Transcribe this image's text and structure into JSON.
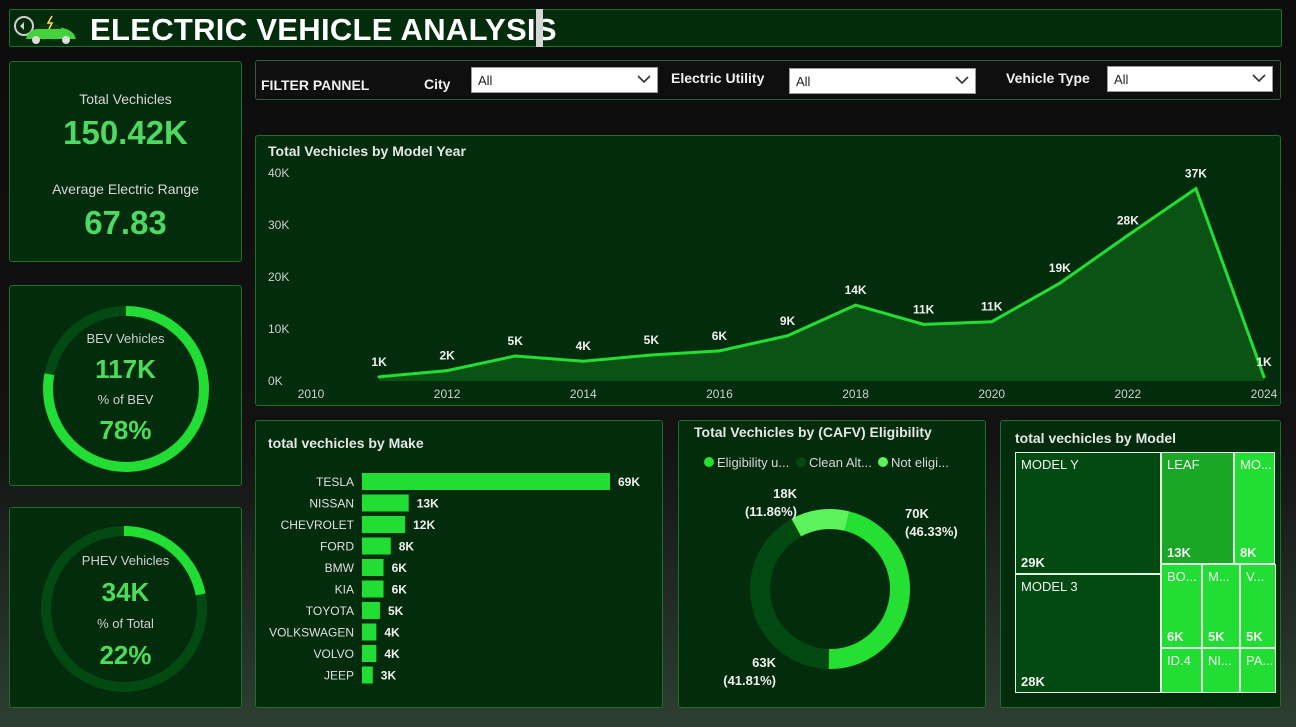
{
  "header": {
    "title": "ELECTRIC VEHICLE ANALYSIS",
    "logo_icon": "ev-car-icon"
  },
  "kpi": {
    "total_label": "Total Vechicles",
    "total_value": "150.42K",
    "range_label": "Average Electric Range",
    "range_value": "67.83"
  },
  "bev": {
    "label": "BEV Vehicles",
    "value": "117K",
    "pct_label": "% of BEV",
    "pct_value": "78%",
    "fraction": 0.78
  },
  "phev": {
    "label": "PHEV Vehicles",
    "value": "34K",
    "pct_label": "% of Total",
    "pct_value": "22%",
    "fraction": 0.22
  },
  "filters": {
    "title": "FILTER PANNEL",
    "city_label": "City",
    "city_value": "All",
    "utility_label": "Electric Utility",
    "utility_value": "All",
    "vehicle_type_label": "Vehicle Type",
    "vehicle_type_value": "All"
  },
  "colors": {
    "accent": "#22dd33",
    "panel": "#022c0b",
    "dark_green": "#034a12",
    "light_green": "#5cf25c"
  },
  "chart_data": [
    {
      "type": "area",
      "title": "Total Vechicles by Model Year",
      "x": [
        2011,
        2012,
        2013,
        2014,
        2015,
        2016,
        2017,
        2018,
        2019,
        2020,
        2021,
        2022,
        2023,
        2024
      ],
      "y": [
        0.8,
        2,
        4.8,
        3.8,
        5,
        5.8,
        8.7,
        14.6,
        10.9,
        11.4,
        18.8,
        28,
        37,
        0.8
      ],
      "data_labels": [
        "1K",
        "2K",
        "5K",
        "4K",
        "5K",
        "6K",
        "9K",
        "14K",
        "11K",
        "11K",
        "19K",
        "28K",
        "37K",
        "1K"
      ],
      "x_ticks": [
        "2010",
        "2012",
        "2014",
        "2016",
        "2018",
        "2020",
        "2022",
        "2024"
      ],
      "y_ticks": [
        "0K",
        "10K",
        "20K",
        "30K",
        "40K"
      ],
      "xlim": [
        2010,
        2024
      ],
      "ylim": [
        0,
        40
      ],
      "grid": false
    },
    {
      "type": "bar",
      "title": "total vechicles by Make",
      "categories": [
        "TESLA",
        "NISSAN",
        "CHEVROLET",
        "FORD",
        "BMW",
        "KIA",
        "TOYOTA",
        "VOLKSWAGEN",
        "VOLVO",
        "JEEP"
      ],
      "values": [
        69,
        13,
        12,
        8,
        6,
        6,
        5,
        4,
        4,
        3
      ],
      "data_labels": [
        "69K",
        "13K",
        "12K",
        "8K",
        "6K",
        "6K",
        "5K",
        "4K",
        "4K",
        "3K"
      ],
      "orientation": "horizontal"
    },
    {
      "type": "pie",
      "title": "Total Vechicles by (CAFV) Eligibility",
      "legend": [
        "Eligibility u...",
        "Clean Alt...",
        "Not eligi..."
      ],
      "legend_placement": "top",
      "slices": [
        {
          "name": "Eligibility u...",
          "value": 70,
          "label": "70K",
          "pct": "(46.33%)",
          "color": "#26df33"
        },
        {
          "name": "Clean Alt...",
          "value": 63,
          "label": "63K",
          "pct": "(41.81%)",
          "color": "#034a12"
        },
        {
          "name": "Not eligi...",
          "value": 18,
          "label": "18K",
          "pct": "(11.86%)",
          "color": "#5cf25c"
        }
      ],
      "donut": true
    },
    {
      "type": "treemap",
      "title": "total vechicles by Model",
      "cells": [
        {
          "name": "MODEL Y",
          "value": "29K"
        },
        {
          "name": "MODEL 3",
          "value": "28K"
        },
        {
          "name": "LEAF",
          "value": "13K"
        },
        {
          "name": "MO...",
          "value": "8K"
        },
        {
          "name": "BO...",
          "value": "6K"
        },
        {
          "name": "M...",
          "value": "5K"
        },
        {
          "name": "V...",
          "value": "5K"
        },
        {
          "name": "ID.4",
          "value": ""
        },
        {
          "name": "NI...",
          "value": ""
        },
        {
          "name": "PA...",
          "value": ""
        }
      ]
    }
  ]
}
